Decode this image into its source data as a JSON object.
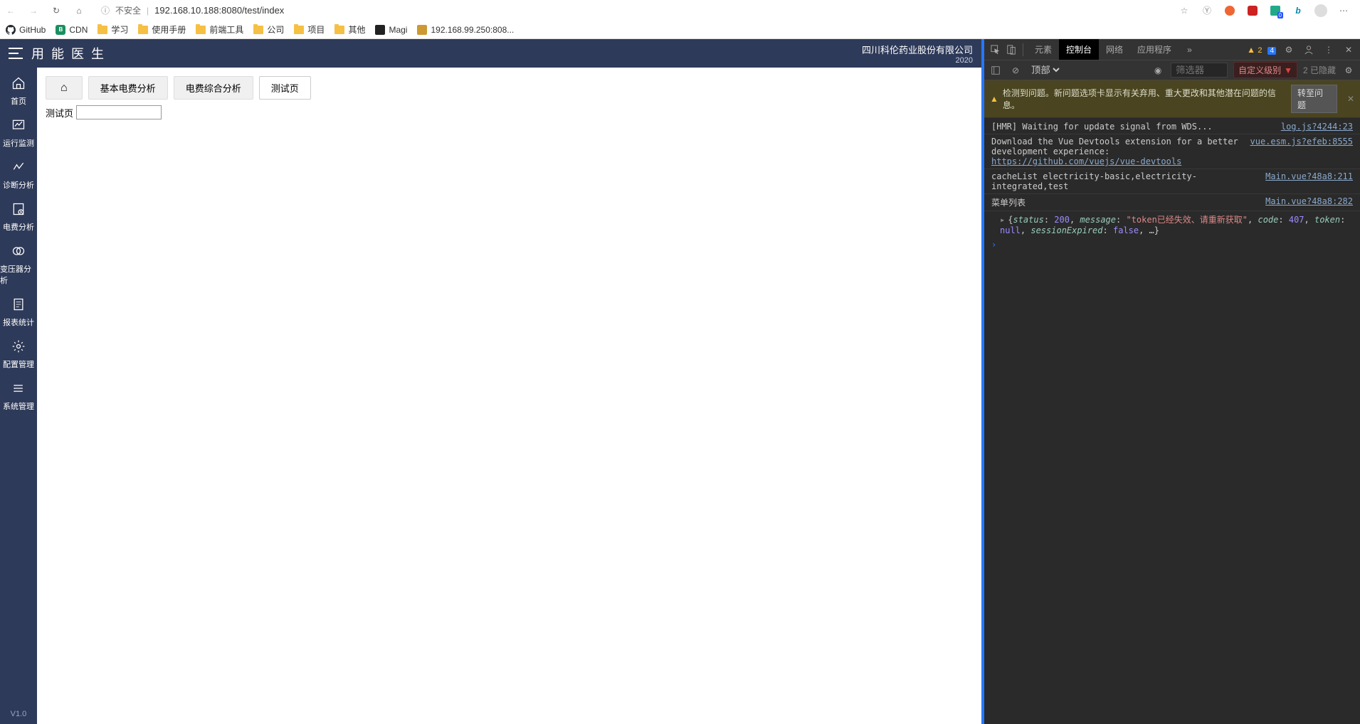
{
  "browser": {
    "insecure_label": "不安全",
    "url": "192.168.10.188:8080/test/index",
    "bookmarks": [
      {
        "icon": "github",
        "label": "GitHub"
      },
      {
        "icon": "cdn",
        "label": "CDN"
      },
      {
        "icon": "folder",
        "label": "学习"
      },
      {
        "icon": "folder",
        "label": "使用手册"
      },
      {
        "icon": "folder",
        "label": "前端工具"
      },
      {
        "icon": "folder",
        "label": "公司"
      },
      {
        "icon": "folder",
        "label": "项目"
      },
      {
        "icon": "folder",
        "label": "其他"
      },
      {
        "icon": "magi",
        "label": "Magi"
      },
      {
        "icon": "ip",
        "label": "192.168.99.250:808..."
      }
    ]
  },
  "app": {
    "title": "用能医生",
    "company": "四川科伦药业股份有限公司",
    "date_prefix": "2020",
    "version": "V1.0",
    "sidebar": [
      {
        "label": "首页",
        "icon": "home"
      },
      {
        "label": "运行监测",
        "icon": "monitor"
      },
      {
        "label": "诊断分析",
        "icon": "diagnosis"
      },
      {
        "label": "电费分析",
        "icon": "cost"
      },
      {
        "label": "变压器分析",
        "icon": "transformer"
      },
      {
        "label": "报表统计",
        "icon": "report"
      },
      {
        "label": "配置管理",
        "icon": "config"
      },
      {
        "label": "系统管理",
        "icon": "system"
      }
    ],
    "tabs": [
      {
        "label": "",
        "home": true
      },
      {
        "label": "基本电费分析"
      },
      {
        "label": "电费综合分析"
      },
      {
        "label": "测试页",
        "active": true
      }
    ],
    "field_label": "测试页"
  },
  "devtools": {
    "tabs": [
      "元素",
      "控制台",
      "网络",
      "应用程序"
    ],
    "active_tab": "控制台",
    "more": "»",
    "warn_count": "2",
    "info_count": "4",
    "context": "顶部",
    "filter_placeholder": "筛选器",
    "level_label": "自定义级别",
    "hidden_label": "2 已隐藏",
    "issues_text": "检测到问题。新问题选项卡显示有关弃用、重大更改和其他潜在问题的信息。",
    "issues_btn": "转至问题",
    "logs": [
      {
        "msg": "[HMR] Waiting for update signal from WDS...",
        "link": "log.js?4244:23"
      },
      {
        "msg_pre": "Download the Vue Devtools extension for a better development experience:",
        "url": "https://github.com/vuejs/vue-devtools",
        "link": "vue.esm.js?efeb:8555"
      },
      {
        "msg": "cacheList electricity-basic,electricity-integrated,test",
        "link": "Main.vue?48a8:211"
      },
      {
        "msg": "菜单列表",
        "link": "Main.vue?48a8:282"
      },
      {
        "object": {
          "status": 200,
          "message": "token已经失效、请重新获取",
          "code": 407,
          "token": "null",
          "sessionExpired": "false"
        }
      }
    ]
  }
}
